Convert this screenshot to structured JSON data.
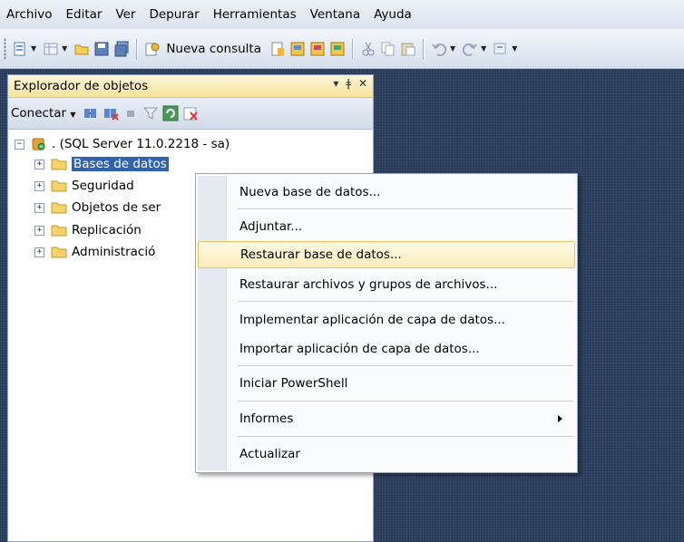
{
  "menubar": {
    "items": [
      "Archivo",
      "Editar",
      "Ver",
      "Depurar",
      "Herramientas",
      "Ventana",
      "Ayuda"
    ]
  },
  "toolbar": {
    "new_query_label": "Nueva consulta"
  },
  "object_explorer": {
    "title": "Explorador de objetos",
    "pin_glyph": "▾ ‡ ✕",
    "connect_label": "Conectar",
    "server_node": ". (SQL Server 11.0.2218 - sa)",
    "nodes": [
      "Bases de datos",
      "Seguridad",
      "Objetos de ser",
      "Replicación",
      "Administració"
    ]
  },
  "context_menu": {
    "items": [
      "Nueva base de datos...",
      "Adjuntar...",
      "Restaurar base de datos...",
      "Restaurar archivos y grupos de archivos...",
      "Implementar aplicación de capa de datos...",
      "Importar aplicación de capa de datos...",
      "Iniciar PowerShell",
      "Informes",
      "Actualizar"
    ],
    "highlighted": "Restaurar base de datos..."
  },
  "colors": {
    "selection": "#2f63ad",
    "hover_fill": "#fbeeb9",
    "workspace": "#2b3c59"
  },
  "icons": [
    "new-query-icon",
    "open-folder-icon",
    "save-icon",
    "save-all-icon",
    "connect-icon",
    "filter-icon",
    "refresh-icon",
    "cut-icon",
    "copy-icon",
    "paste-icon",
    "undo-icon",
    "redo-icon",
    "server-icon",
    "folder-icon",
    "submenu-arrow-icon"
  ]
}
